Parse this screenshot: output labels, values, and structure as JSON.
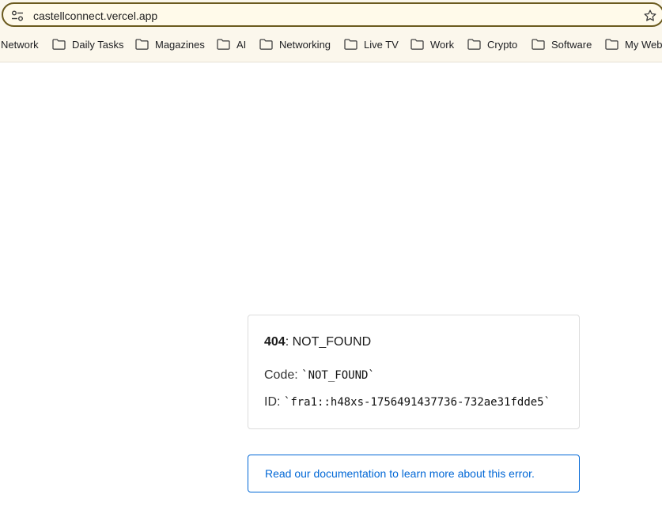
{
  "browser": {
    "url": "castellconnect.vercel.app",
    "icons": {
      "site_settings": "tune-icon",
      "bookmark": "star-icon",
      "folder": "folder-icon"
    },
    "bookmarks": [
      {
        "label": "Network",
        "folder": false
      },
      {
        "label": "Daily Tasks",
        "folder": true
      },
      {
        "label": "Magazines",
        "folder": true
      },
      {
        "label": "AI",
        "folder": true
      },
      {
        "label": "Networking",
        "folder": true
      },
      {
        "label": "Live TV",
        "folder": true
      },
      {
        "label": "Work",
        "folder": true
      },
      {
        "label": "Crypto",
        "folder": true
      },
      {
        "label": "Software",
        "folder": true
      },
      {
        "label": "My Webs",
        "folder": true
      }
    ]
  },
  "error": {
    "code_number": "404",
    "code_name": ": NOT_FOUND",
    "code_label": "Code: ",
    "code_value": "`NOT_FOUND`",
    "id_label": "ID: ",
    "id_value": "`fra1::h48xs-1756491437736-732ae31fdde5`"
  },
  "docs": {
    "link_text": "Read our documentation to learn more about this error."
  },
  "colors": {
    "accent_link": "#0067d6",
    "chrome_bg": "#fbf7ec",
    "address_border": "#6b5a1e"
  }
}
